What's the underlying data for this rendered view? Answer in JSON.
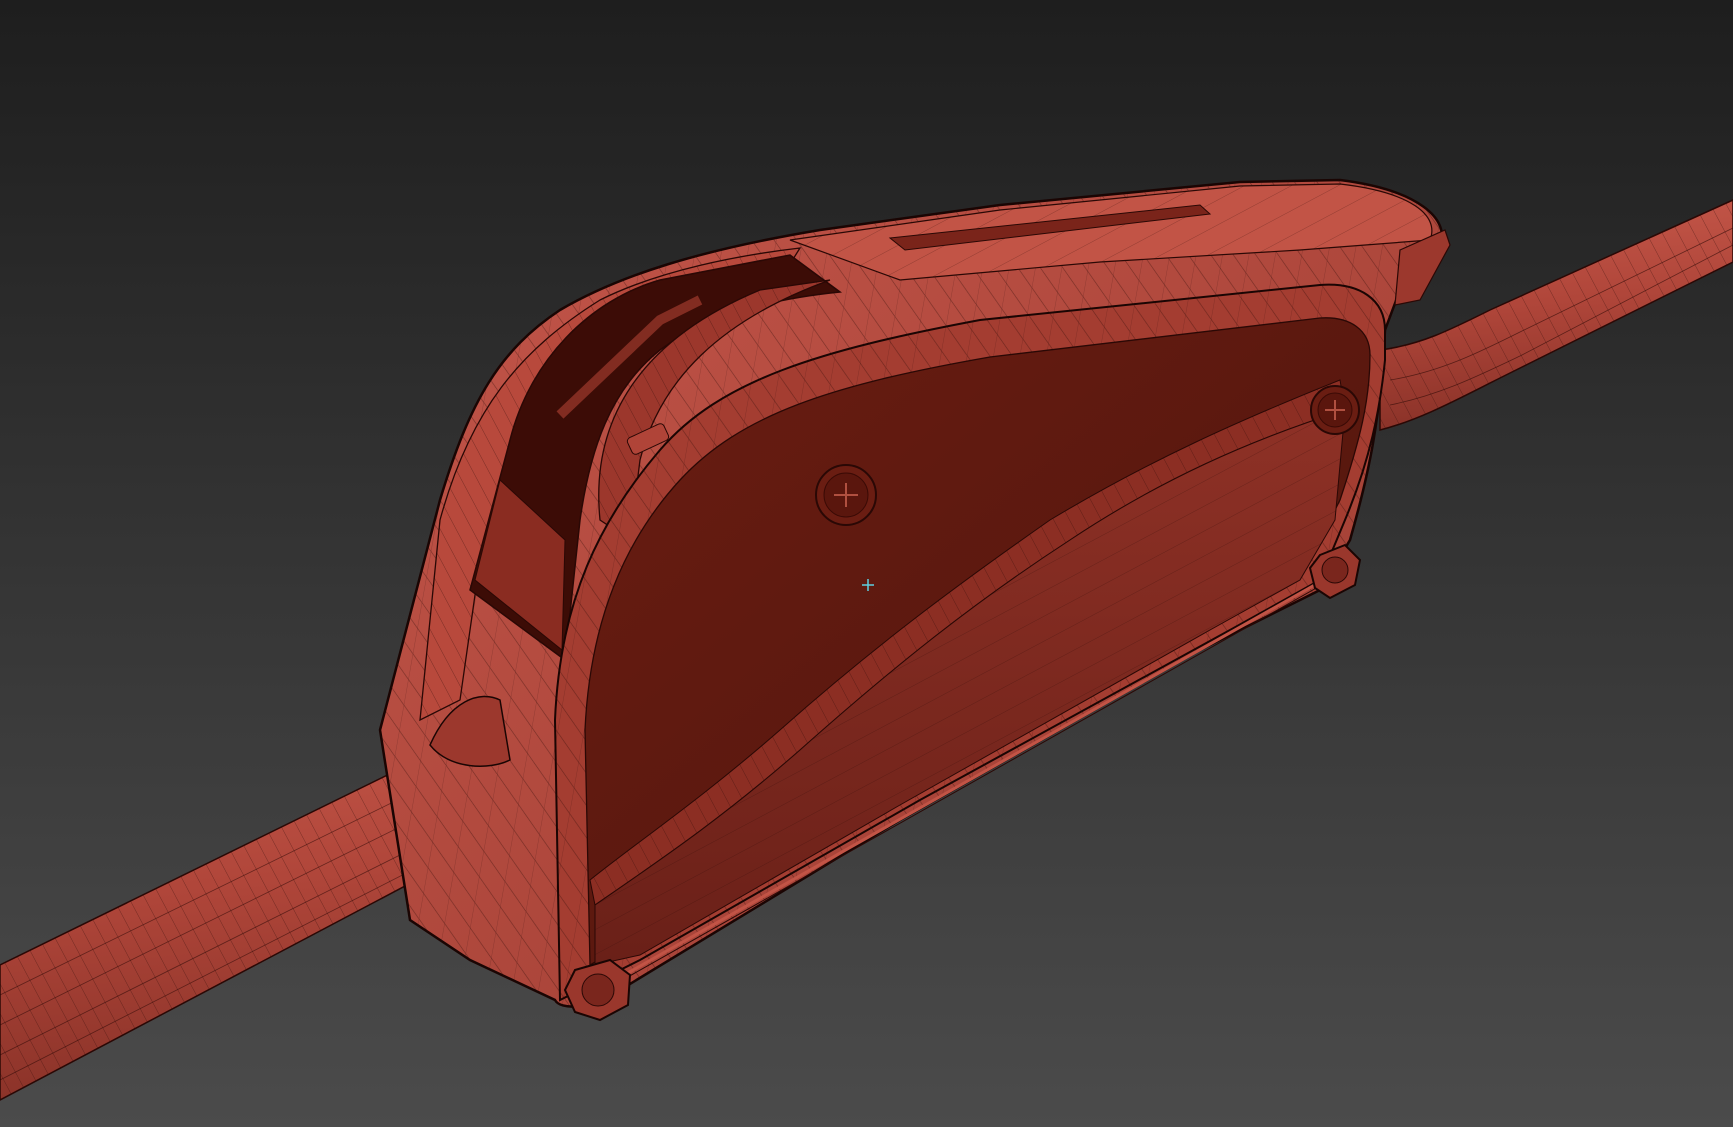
{
  "viewport": {
    "background_top": "#1e1e1e",
    "background_bottom": "#4a4a4a",
    "model_color": "#b5453a",
    "model_face_color": "#5e1a10",
    "wire_color": "#2a0805",
    "crosshair_color": "#5fd0e0"
  }
}
